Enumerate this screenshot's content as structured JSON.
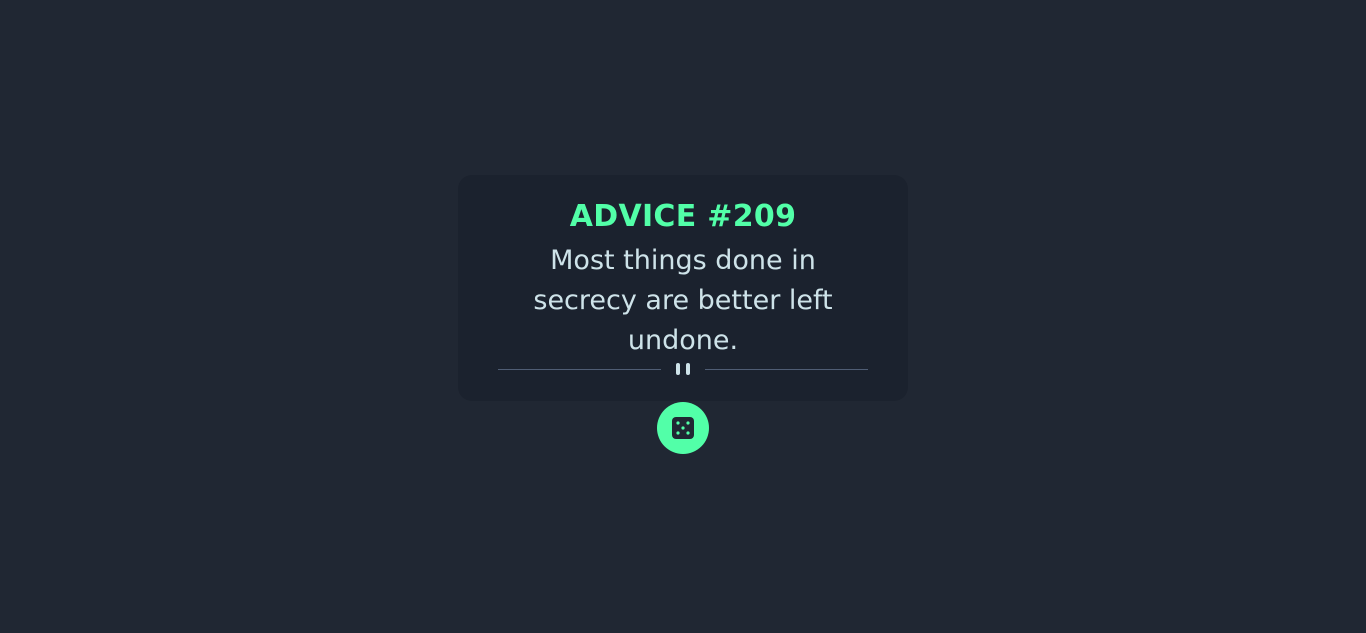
{
  "advice": {
    "id_label": "ADVICE #209",
    "text": "Most things done in secrecy are better left undone."
  },
  "divider": {
    "icon": "pause-icon"
  },
  "button": {
    "icon": "dice-icon"
  },
  "colors": {
    "background": "#202733",
    "card": "#1b222e",
    "accent": "#52ffa8",
    "text": "#cee3e9",
    "divider": "#4f5d74"
  }
}
